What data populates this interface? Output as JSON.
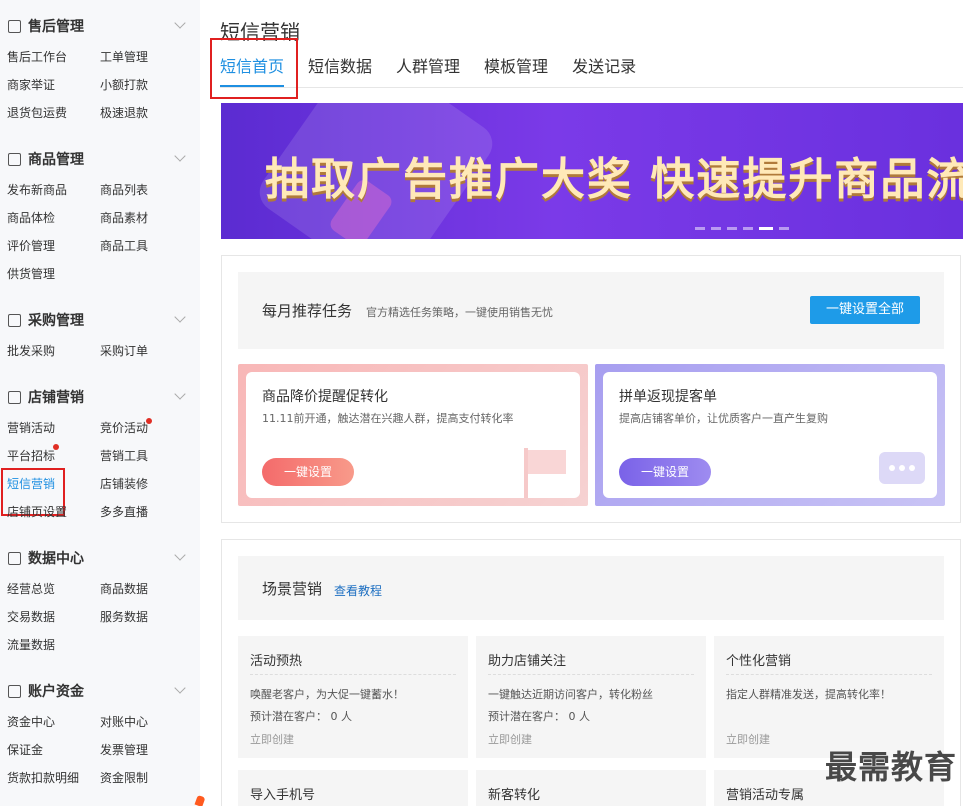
{
  "sidebar": {
    "sections": [
      {
        "title": "售后管理",
        "icon": "shield-icon",
        "items": [
          "售后工作台",
          "工单管理",
          "商家举证",
          "小额打款",
          "退货包运费",
          "极速退款"
        ]
      },
      {
        "title": "商品管理",
        "icon": "box-icon",
        "items": [
          "发布新商品",
          "商品列表",
          "商品体检",
          "商品素材",
          "评价管理",
          "商品工具",
          "供货管理"
        ]
      },
      {
        "title": "采购管理",
        "icon": "list-icon",
        "items": [
          "批发采购",
          "采购订单"
        ]
      },
      {
        "title": "店铺营销",
        "icon": "shop-icon",
        "items": [
          "营销活动",
          "竞价活动",
          "平台招标",
          "营销工具",
          "短信营销",
          "店铺装修",
          "店铺页设置",
          "多多直播"
        ]
      },
      {
        "title": "数据中心",
        "icon": "bar-chart-icon",
        "items": [
          "经营总览",
          "商品数据",
          "交易数据",
          "服务数据",
          "流量数据"
        ]
      },
      {
        "title": "账户资金",
        "icon": "yuan-icon",
        "items": [
          "资金中心",
          "对账中心",
          "保证金",
          "发票管理",
          "货款扣款明细",
          "资金限制"
        ]
      }
    ],
    "active_item": "短信营销"
  },
  "page": {
    "title": "短信营销",
    "tabs": [
      "短信首页",
      "短信数据",
      "人群管理",
      "模板管理",
      "发送记录"
    ],
    "active_tab": "短信首页"
  },
  "banner": {
    "text": "抽取广告推广大奖  快速提升商品流",
    "dots": 6,
    "active_dot": 4,
    "gradient": [
      "#5b2bd1",
      "#7b3ae8"
    ]
  },
  "monthly": {
    "title": "每月推荐任务",
    "subtitle": "官方精选任务策略，一键使用销售无忧",
    "button": "一键设置全部",
    "cards": [
      {
        "title": "商品降价提醒促转化",
        "desc": "11.11前开通，触达潜在兴趣人群，提高支付转化率",
        "button": "一键设置",
        "theme": "red"
      },
      {
        "title": "拼单返现提客单",
        "desc": "提高店铺客单价，让优质客户一直产生复购",
        "button": "一键设置",
        "theme": "purple"
      }
    ]
  },
  "scene": {
    "title": "场景营销",
    "link": "查看教程",
    "cards": [
      {
        "title": "活动预热",
        "desc": "唤醒老客户，为大促一键蓄水！",
        "potential": "预计潜在客户： 0 人",
        "action": "立即创建"
      },
      {
        "title": "助力店铺关注",
        "desc": "一键触达近期访问客户，转化粉丝",
        "potential": "预计潜在客户： 0 人",
        "action": "立即创建"
      },
      {
        "title": "个性化营销",
        "desc": "指定人群精准发送，提高转化率！",
        "potential": "",
        "action": "立即创建"
      }
    ],
    "more_cards": [
      "导入手机号",
      "新客转化",
      "营销活动专属"
    ]
  },
  "watermark": "最需教育"
}
